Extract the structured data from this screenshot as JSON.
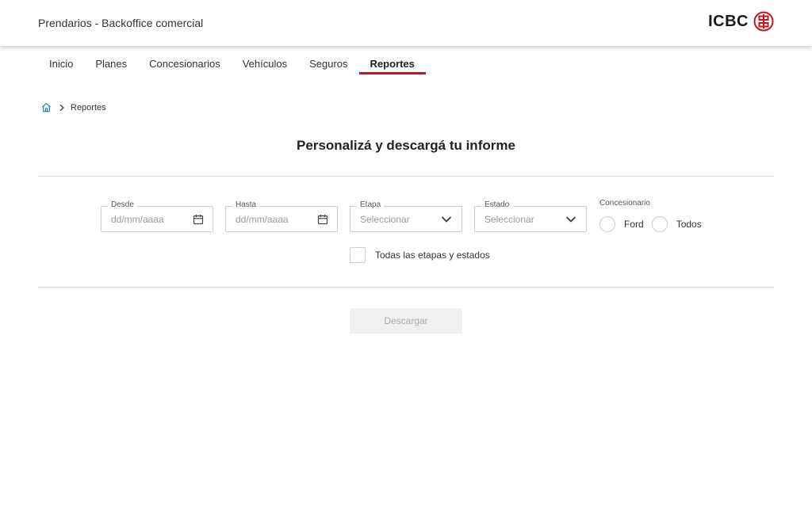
{
  "header": {
    "title": "Prendarios - Backoffice comercial",
    "brand_name": "ICBC",
    "brand_color": "#c4161c"
  },
  "nav": {
    "tabs": [
      {
        "label": "Inicio"
      },
      {
        "label": "Planes"
      },
      {
        "label": "Concesionarios"
      },
      {
        "label": "Vehículos"
      },
      {
        "label": "Seguros"
      },
      {
        "label": "Reportes",
        "active": true
      }
    ]
  },
  "breadcrumb": {
    "home_icon": "home-icon",
    "current": "Reportes"
  },
  "page": {
    "title": "Personalizá y descargá tu informe"
  },
  "filters": {
    "desde": {
      "label": "Desde",
      "placeholder": "dd/mm/aaaa",
      "icon": "calendar-icon"
    },
    "hasta": {
      "label": "Hasta",
      "placeholder": "dd/mm/aaaa",
      "icon": "calendar-icon"
    },
    "etapa": {
      "label": "Etapa",
      "placeholder": "Seleccionar",
      "icon": "chevron-down-icon"
    },
    "estado": {
      "label": "Estado",
      "placeholder": "Seleccionar",
      "icon": "chevron-down-icon"
    },
    "concesionario": {
      "label": "Concesionario",
      "options": [
        {
          "label": "Ford",
          "selected": false
        },
        {
          "label": "Todos",
          "selected": false
        }
      ]
    },
    "all_stages_checkbox": {
      "label": "Todas las etapas y estados",
      "checked": false
    }
  },
  "actions": {
    "download_label": "Descargar",
    "download_disabled": true
  }
}
